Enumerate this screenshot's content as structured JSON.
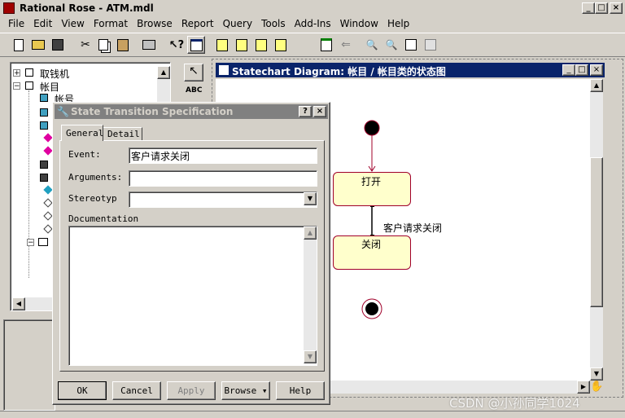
{
  "app": {
    "title": "Rational Rose - ATM.mdl",
    "window_buttons": [
      "_",
      "□",
      "×"
    ]
  },
  "menu": [
    "File",
    "Edit",
    "View",
    "Format",
    "Browse",
    "Report",
    "Query",
    "Tools",
    "Add-Ins",
    "Window",
    "Help"
  ],
  "toolbar": {
    "icons": [
      "new-file-icon",
      "open-folder-icon",
      "save-icon",
      "cut-icon",
      "copy-icon",
      "paste-icon",
      "print-icon",
      "context-help-icon",
      "view-doc-icon",
      "browse-class-icon",
      "browse-interaction-icon",
      "browse-component-icon",
      "browse-deployment-icon",
      "browse-parent-icon",
      "browse-previous-icon",
      "zoom-in-icon",
      "zoom-out-icon",
      "fit-window-icon",
      "undo-fit-icon"
    ]
  },
  "browser": {
    "items": [
      {
        "label": "取钱机"
      },
      {
        "label": "帐目"
      },
      {
        "label": "帐号"
      }
    ]
  },
  "palette": {
    "text_tool": "ABC"
  },
  "diagram": {
    "title": "Statechart Diagram: 帐目 / 帐目类的状态图",
    "state_open": "打开",
    "state_close": "关闭",
    "transition_label": "客户请求关闭"
  },
  "dialog": {
    "title": "State Transition Specification",
    "help_btn": "?",
    "close_btn": "×",
    "tabs": [
      "General",
      "Detail"
    ],
    "event_label": "Event:",
    "event_value": "客户请求关闭",
    "arguments_label": "Arguments:",
    "arguments_value": "",
    "stereotype_label": "Stereotyp",
    "stereotype_value": "",
    "documentation_label": "Documentation",
    "ok": "OK",
    "cancel": "Cancel",
    "apply": "Apply",
    "browse": "Browse ▾",
    "help": "Help"
  },
  "watermark": "CSDN @小孙同学1024",
  "colors": {
    "desktop": "#d4d0c8",
    "active_title": "#0a246a",
    "inactive_title": "#808080",
    "state_fill": "#ffffcc",
    "state_border": "#a0002a"
  }
}
